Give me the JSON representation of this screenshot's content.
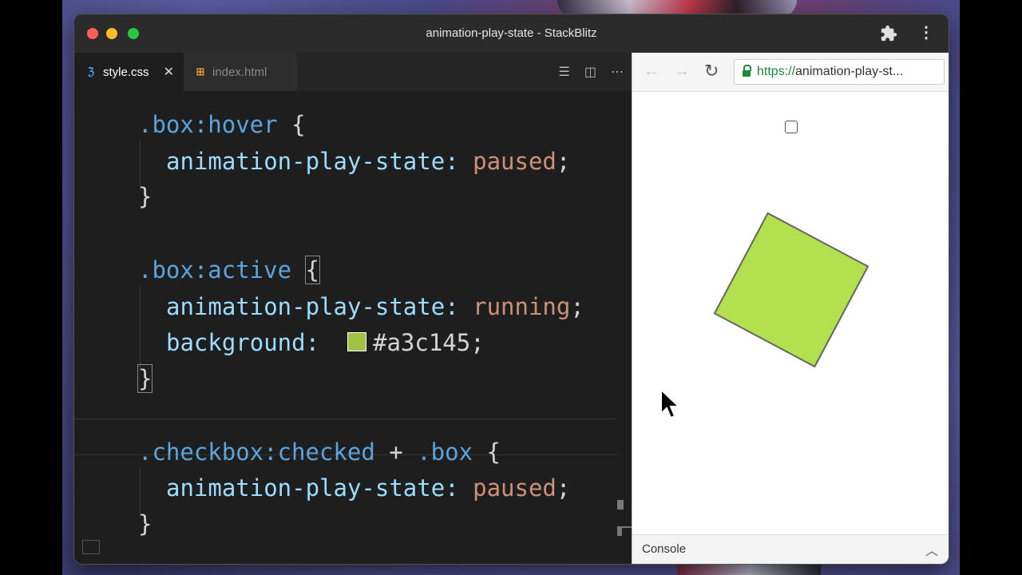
{
  "window": {
    "title": "animation-play-state - StackBlitz"
  },
  "editor": {
    "tabs": [
      {
        "label": "style.css",
        "icon": "css-file-icon",
        "active": true,
        "close": "✕"
      },
      {
        "label": "index.html",
        "icon": "html-file-icon",
        "active": false
      }
    ],
    "code": {
      "l1_sel": ".box:hover",
      "l1_brace": " {",
      "l2_prop": "animation-play-state:",
      "l2_val": " paused",
      "l2_end": ";",
      "l3": "}",
      "l4_sel": ".box:active",
      "l4_brace": "{",
      "l5_prop": "animation-play-state:",
      "l5_val": " running",
      "l5_end": ";",
      "l6_prop": "background:",
      "l6_hex": "#a3c145;",
      "l7": "}",
      "l8_sel1": ".checkbox:checked",
      "l8_plus": " + ",
      "l8_sel2": ".box",
      "l8_brace": " {",
      "l9_prop": "animation-play-state:",
      "l9_val": " paused",
      "l9_end": ";",
      "l10": "}"
    },
    "swatch_color": "#a3c145"
  },
  "preview": {
    "url_scheme": "https://",
    "url_rest": "animation-play-st...",
    "console_label": "Console",
    "box_color": "#b3e04f"
  },
  "colors": {
    "css_blue": "#42a5f5",
    "html_orange": "#e8912d",
    "lock_green": "#1b8a3a"
  }
}
